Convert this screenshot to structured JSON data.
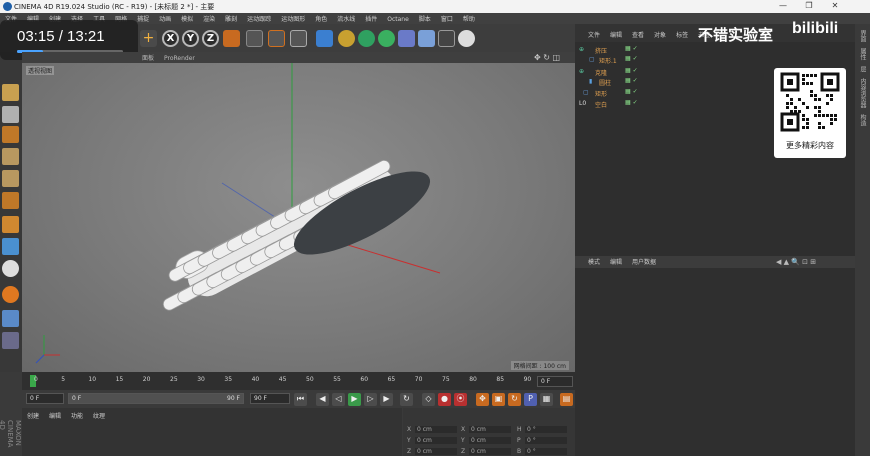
{
  "window": {
    "title": "CINEMA 4D R19.024 Studio (RC - R19) - [未标题 2 *] - 主要",
    "minimize": "—",
    "maximize": "❐",
    "close": "✕"
  },
  "menu": [
    "文件",
    "编辑",
    "创建",
    "选择",
    "工具",
    "网格",
    "捕捉",
    "动画",
    "模拟",
    "渲染",
    "雕刻",
    "运动跟踪",
    "运动图形",
    "角色",
    "流水线",
    "插件",
    "Octane",
    "脚本",
    "窗口",
    "帮助"
  ],
  "video": {
    "time": "03:15 / 13:21",
    "progress": 0.243
  },
  "toolbar": {
    "plus": "+",
    "x": "X",
    "y": "Y",
    "z": "Z"
  },
  "viewport_header": {
    "items": [
      "面板",
      "ProRender"
    ]
  },
  "viewport": {
    "label": "透视视图",
    "grid_distance": "网格间距 : 100 cm"
  },
  "timeline": {
    "ticks": [
      "0",
      "5",
      "10",
      "15",
      "20",
      "25",
      "30",
      "35",
      "40",
      "45",
      "50",
      "55",
      "60",
      "65",
      "70",
      "75",
      "80",
      "85",
      "90"
    ],
    "end_field": "0 F"
  },
  "playbar": {
    "start": "0 F",
    "range_start": "0 F",
    "range_end": "90 F",
    "end": "90 F"
  },
  "material_panel": {
    "tabs": [
      "创建",
      "编辑",
      "功能",
      "纹理"
    ]
  },
  "coords": {
    "rows": [
      {
        "a": "X",
        "av": "0 cm",
        "b": "X",
        "bv": "0 cm",
        "c": "H",
        "cv": "0 °"
      },
      {
        "a": "Y",
        "av": "0 cm",
        "b": "Y",
        "bv": "0 cm",
        "c": "P",
        "cv": "0 °"
      },
      {
        "a": "Z",
        "av": "0 cm",
        "b": "Z",
        "bv": "0 cm",
        "c": "B",
        "cv": "0 °"
      }
    ]
  },
  "object_manager": {
    "tabs": [
      "文件",
      "编辑",
      "查看",
      "对象",
      "标签",
      "书签"
    ],
    "objects": [
      {
        "name": "挤压"
      },
      {
        "name": "矩形.1"
      },
      {
        "name": "克隆"
      },
      {
        "name": "圆柱"
      },
      {
        "name": "矩形"
      },
      {
        "name": "空白"
      }
    ]
  },
  "attribute_manager": {
    "tabs": [
      "模式",
      "编辑",
      "用户数据"
    ]
  },
  "right_sidebar": [
    "界面",
    "属性",
    "层",
    "内容浏览器",
    "构造"
  ],
  "overlay_brand": {
    "text": "不错实验室",
    "logo": "bilibili"
  },
  "qr": {
    "caption": "更多精彩内容"
  },
  "colors": {
    "accent": "#4aa3ff",
    "object_label": "#e0a050"
  }
}
